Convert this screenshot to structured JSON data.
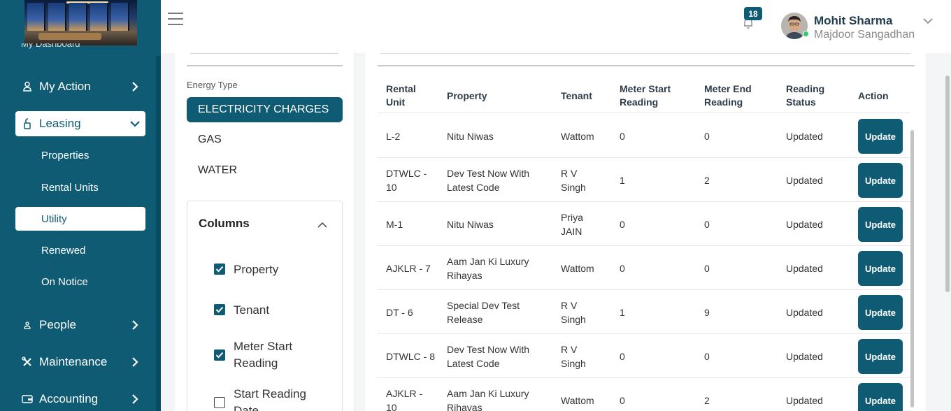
{
  "sidebar": {
    "partial_item": "My Dashboard",
    "items": [
      {
        "label": "My Action",
        "icon": "person-icon",
        "top": 0
      },
      {
        "label": "Leasing",
        "icon": "lock-icon"
      },
      {
        "label": "People",
        "icon": "people-icon"
      },
      {
        "label": "Maintenance",
        "icon": "tools-icon"
      },
      {
        "label": "Accounting",
        "icon": "wallet-icon"
      }
    ],
    "leasing_sub": [
      "Properties",
      "Rental Units",
      "Utility",
      "Renewed",
      "On Notice"
    ],
    "active_sub": "Utility"
  },
  "header": {
    "notification_count": "18",
    "user_name": "Mohit Sharma",
    "user_org": "Majdoor Sangadhan"
  },
  "filters": {
    "energy_type_label": "Energy Type",
    "energy_options": [
      "ELECTRICITY CHARGES",
      "GAS",
      "WATER"
    ],
    "selected_energy": "ELECTRICITY CHARGES",
    "columns_title": "Columns",
    "columns": [
      {
        "label": "Property",
        "checked": true
      },
      {
        "label": "Tenant",
        "checked": true
      },
      {
        "label": "Meter Start Reading",
        "checked": true
      },
      {
        "label": "Start Reading Date",
        "checked": false
      }
    ]
  },
  "table": {
    "headers": [
      "Rental Unit",
      "Property",
      "Tenant",
      "Meter Start Reading",
      "Meter End Reading",
      "Reading Status",
      "Action"
    ],
    "action_label": "Update",
    "rows": [
      {
        "unit": "L-2",
        "property": "Nitu Niwas",
        "tenant": "Wattom",
        "start": "0",
        "end": "0",
        "status": "Updated"
      },
      {
        "unit": "DTWLC - 10",
        "property": "Dev Test Now With Latest Code",
        "tenant": "R V Singh",
        "start": "1",
        "end": "2",
        "status": "Updated"
      },
      {
        "unit": "M-1",
        "property": "Nitu Niwas",
        "tenant": "Priya JAIN",
        "start": "0",
        "end": "0",
        "status": "Updated"
      },
      {
        "unit": "AJKLR - 7",
        "property": "Aam Jan Ki Luxury Rihayas",
        "tenant": "Wattom",
        "start": "0",
        "end": "0",
        "status": "Updated"
      },
      {
        "unit": "DT - 6",
        "property": "Special Dev Test Release",
        "tenant": "R V Singh",
        "start": "1",
        "end": "9",
        "status": "Updated"
      },
      {
        "unit": "DTWLC - 8",
        "property": "Dev Test Now With Latest Code",
        "tenant": "R V Singh",
        "start": "0",
        "end": "0",
        "status": "Updated"
      },
      {
        "unit": "AJKLR - 10",
        "property": "Aam Jan Ki Luxury Rihayas",
        "tenant": "Wattom",
        "start": "0",
        "end": "2",
        "status": "Updated"
      }
    ]
  },
  "colors": {
    "brand": "#0e5b73",
    "online": "#2ecc71"
  }
}
